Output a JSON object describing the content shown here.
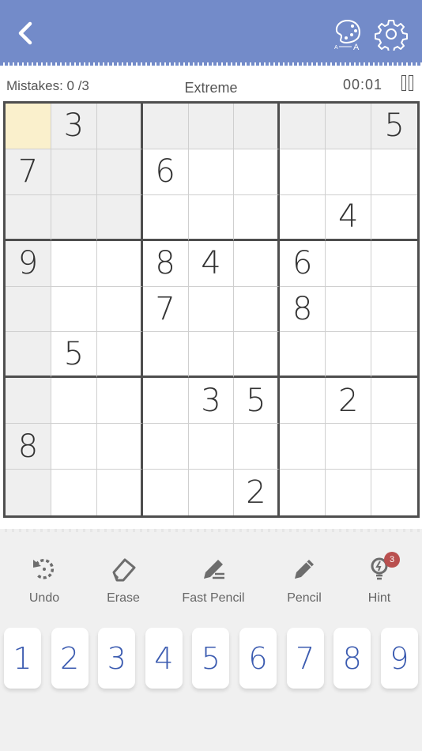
{
  "header": {
    "back_icon": "chevron-left-icon",
    "theme_icon": "palette-icon",
    "settings_icon": "gear-icon",
    "background_color": "#738bc9"
  },
  "status": {
    "mistakes": "Mistakes: 0 /3",
    "difficulty": "Extreme",
    "timer": "00:01",
    "pause_icon": "pause-icon"
  },
  "board": {
    "selected": {
      "row": 0,
      "col": 0
    },
    "selected_color": "#faf0cc",
    "highlight_color": "#efefef",
    "cells": [
      [
        "",
        "3",
        "",
        "",
        "",
        "",
        "",
        "",
        "5"
      ],
      [
        "7",
        "",
        "",
        "6",
        "",
        "",
        "",
        "",
        ""
      ],
      [
        "",
        "",
        "",
        "",
        "",
        "",
        "",
        "4",
        ""
      ],
      [
        "9",
        "",
        "",
        "8",
        "4",
        "",
        "6",
        "",
        ""
      ],
      [
        "",
        "",
        "",
        "7",
        "",
        "",
        "8",
        "",
        ""
      ],
      [
        "",
        "5",
        "",
        "",
        "",
        "",
        "",
        "",
        ""
      ],
      [
        "",
        "",
        "",
        "",
        "3",
        "5",
        "",
        "2",
        ""
      ],
      [
        "8",
        "",
        "",
        "",
        "",
        "",
        "",
        "",
        ""
      ],
      [
        "",
        "",
        "",
        "",
        "",
        "2",
        "",
        "",
        ""
      ]
    ]
  },
  "tools": [
    {
      "label": "Undo",
      "icon": "undo-icon"
    },
    {
      "label": "Erase",
      "icon": "eraser-icon"
    },
    {
      "label": "Fast Pencil",
      "icon": "fast-pencil-icon"
    },
    {
      "label": "Pencil",
      "icon": "pencil-icon"
    },
    {
      "label": "Hint",
      "icon": "lightbulb-icon",
      "badge": "3"
    }
  ],
  "numpad": [
    "1",
    "2",
    "3",
    "4",
    "5",
    "6",
    "7",
    "8",
    "9"
  ],
  "colors": {
    "digit_key": "#3b5bb0",
    "hint_badge": "#b9504f"
  }
}
